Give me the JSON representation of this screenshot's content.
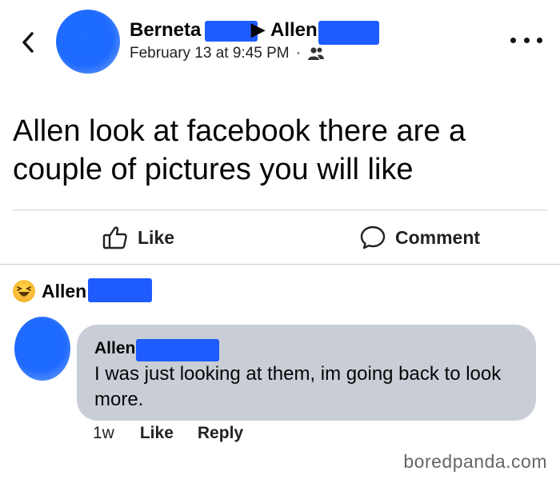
{
  "header": {
    "author_name": "Berneta",
    "target_name": "Allen",
    "arrow": "▶",
    "timestamp": "February 13 at 9:45 PM",
    "separator": "·",
    "audience_icon": "friends-icon"
  },
  "post": {
    "text": "Allen look at facebook there are a couple of pictures you will like"
  },
  "actions": {
    "like_label": "Like",
    "comment_label": "Comment"
  },
  "reaction": {
    "emoji": "laughing-emoji",
    "name": "Allen"
  },
  "comment": {
    "author": "Allen",
    "text": "I was just looking at them, im going back to look more.",
    "time": "1w",
    "like_label": "Like",
    "reply_label": "Reply"
  },
  "watermark": "boredpanda.com",
  "colors": {
    "redaction": "#1f5cff",
    "bubble": "#c9ced6",
    "divider": "#ced0d4"
  }
}
